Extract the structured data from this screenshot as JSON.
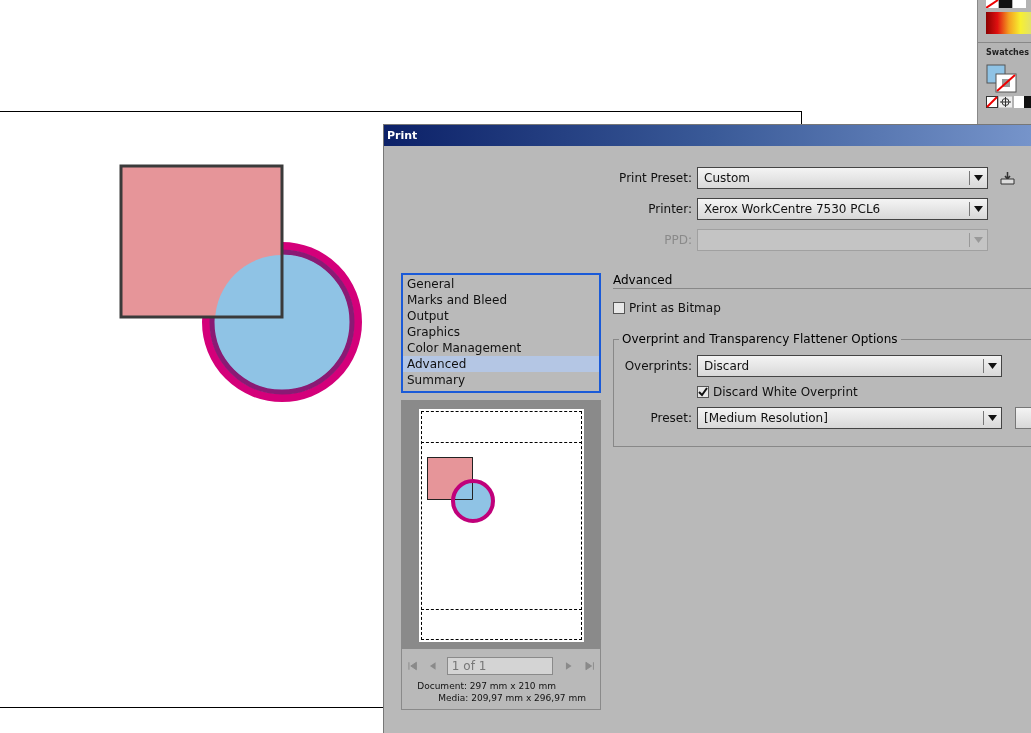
{
  "swatches_panel": {
    "title": "Swatches"
  },
  "dialog": {
    "title": "Print",
    "print_preset": {
      "label": "Print Preset:",
      "value": "Custom",
      "disabled": false
    },
    "printer": {
      "label": "Printer:",
      "value": "Xerox WorkCentre 7530 PCL6",
      "disabled": false
    },
    "ppd": {
      "label": "PPD:",
      "disabled": true
    },
    "categories": [
      {
        "label": "General",
        "selected": false
      },
      {
        "label": "Marks and Bleed",
        "selected": false
      },
      {
        "label": "Output",
        "selected": false
      },
      {
        "label": "Graphics",
        "selected": false
      },
      {
        "label": "Color Management",
        "selected": false
      },
      {
        "label": "Advanced",
        "selected": true
      },
      {
        "label": "Summary",
        "selected": false
      }
    ],
    "preview": {
      "page_field": "1 of 1",
      "document": "Document: 297 mm x 210 mm",
      "media": "Media: 209,97 mm x 296,97 mm"
    },
    "advanced": {
      "heading": "Advanced",
      "print_as_bitmap": {
        "label": "Print as Bitmap",
        "checked": false
      },
      "group_title": "Overprint and Transparency Flattener Options",
      "overprints": {
        "label": "Overprints:",
        "value": "Discard"
      },
      "discard_white_overprint": {
        "label": "Discard White Overprint",
        "checked": true
      },
      "preset": {
        "label": "Preset:",
        "value": "[Medium Resolution]"
      }
    }
  }
}
